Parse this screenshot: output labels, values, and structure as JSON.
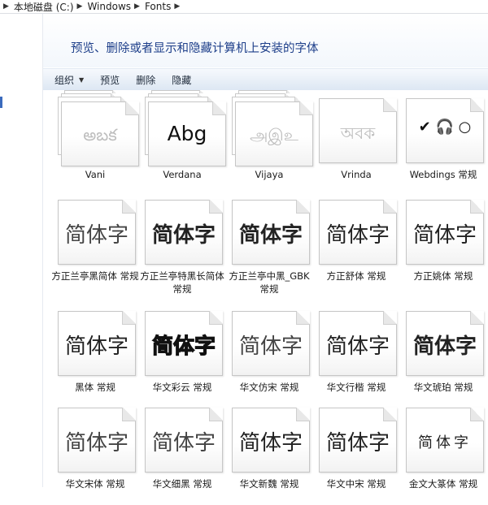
{
  "breadcrumb": {
    "items": [
      "本地磁盘 (C:)",
      "Windows",
      "Fonts"
    ]
  },
  "header": {
    "title": "预览、删除或者显示和隐藏计算机上安装的字体"
  },
  "toolbar": {
    "organize": "组织",
    "preview": "预览",
    "delete": "删除",
    "hide": "隐藏"
  },
  "fonts": [
    {
      "name": "Vani",
      "sample": "అబక",
      "style": "faded-stack"
    },
    {
      "name": "Verdana",
      "sample": "Abg",
      "style": "stack"
    },
    {
      "name": "Vijaya",
      "sample": "அஇஉ",
      "style": "faded-stack"
    },
    {
      "name": "Vrinda",
      "sample": "অবক",
      "style": "faded"
    },
    {
      "name": "Webdings 常规",
      "sample": "✔ 🎧 ○",
      "style": "symbol"
    },
    {
      "name": "方正兰亭黑简体 常规",
      "sample": "简体字",
      "style": "light"
    },
    {
      "name": "方正兰亭特黑长简体 常规",
      "sample": "简体字",
      "style": "bold"
    },
    {
      "name": "方正兰亭中黑_GBK 常规",
      "sample": "简体字",
      "style": "bold"
    },
    {
      "name": "方正舒体 常规",
      "sample": "简体字",
      "style": "serif"
    },
    {
      "name": "方正姚体 常规",
      "sample": "简体字",
      "style": "serif"
    },
    {
      "name": "黑体 常规",
      "sample": "简体字",
      "style": "normal"
    },
    {
      "name": "华文彩云 常规",
      "sample": "简体字",
      "style": "outline"
    },
    {
      "name": "华文仿宋 常规",
      "sample": "简体字",
      "style": "serif-light"
    },
    {
      "name": "华文行楷 常规",
      "sample": "简体字",
      "style": "serif"
    },
    {
      "name": "华文琥珀 常规",
      "sample": "简体字",
      "style": "bold"
    },
    {
      "name": "华文宋体 常规",
      "sample": "简体字",
      "style": "serif-light"
    },
    {
      "name": "华文细黑 常规",
      "sample": "简体字",
      "style": "light"
    },
    {
      "name": "华文新魏 常规",
      "sample": "简体字",
      "style": "serif"
    },
    {
      "name": "华文中宋 常规",
      "sample": "简体字",
      "style": "serif"
    },
    {
      "name": "金文大篆体 常规",
      "sample": "简体字",
      "style": "seal"
    }
  ]
}
